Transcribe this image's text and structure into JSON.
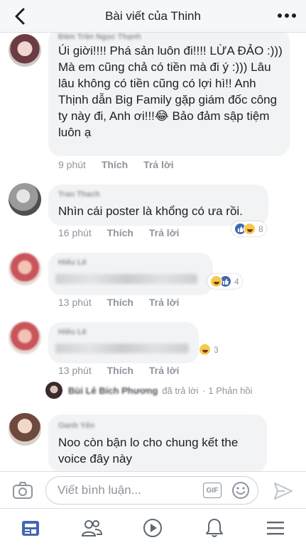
{
  "header": {
    "title": "Bài viết của Thinh"
  },
  "comments": [
    {
      "name": "Đàm Trần Ngọc Thạnh",
      "text": "Úi giời!!!! Phá sản luôn đi!!!!  LỪA ĐẢO :))) Mà em cũng chả có tiền mà  đi ý :))) Lâu lâu không có tiền cũng có lợi hì!!  Anh Thịnh dẫn Big Family gặp giám đốc công ty này đi, Anh ơi!!!😂 Bảo đảm sập  tiệm luôn ạ",
      "time": "9 phút",
      "like": "Thích",
      "reply": "Trả lời"
    },
    {
      "name": "Tran Thach",
      "text": "Nhìn cái poster là khổng có ưa rồi.",
      "time": "16 phút",
      "like": "Thích",
      "reply": "Trả lời",
      "reaction_count": "8"
    },
    {
      "name": "Hiếu Lê",
      "time": "13 phút",
      "like": "Thích",
      "reply": "Trả lời",
      "reaction_count": "4"
    },
    {
      "name": "Hiếu Lê",
      "time": "13 phút",
      "like": "Thích",
      "reply": "Trả lời",
      "reaction_count": "3",
      "reply_summary": {
        "name": "Bùi Lê Bích Phương",
        "action": "đã trả lời",
        "count": "· 1 Phản hồi"
      }
    },
    {
      "name": "Oanh Yến",
      "text": "Noo còn bận lo cho chung kết the voice đây này"
    }
  ],
  "composer": {
    "placeholder": "Viết bình luận...",
    "gif_label": "GIF"
  },
  "icons": {
    "back": "chevron-left-icon",
    "more": "more-dots-icon",
    "camera": "camera-icon",
    "gif": "gif-icon",
    "emoji": "emoji-icon",
    "send": "send-icon",
    "tabs": [
      "news-feed-icon",
      "friends-icon",
      "watch-icon",
      "notifications-icon",
      "menu-icon"
    ]
  },
  "colors": {
    "brand": "#4267b2",
    "bubble": "#f2f3f5",
    "meta": "#90949c",
    "haha": "#f7c94a"
  }
}
